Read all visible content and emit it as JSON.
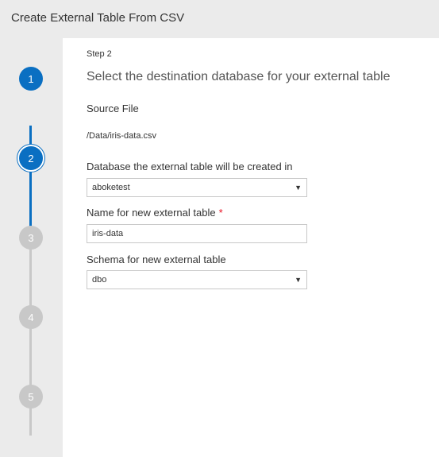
{
  "window": {
    "title": "Create External Table From CSV"
  },
  "stepper": {
    "steps": [
      {
        "number": "1",
        "state": "complete"
      },
      {
        "number": "2",
        "state": "active"
      },
      {
        "number": "3",
        "state": "pending"
      },
      {
        "number": "4",
        "state": "pending"
      },
      {
        "number": "5",
        "state": "pending"
      }
    ],
    "colors": {
      "active": "#0a6fc2",
      "pending": "#c8c8c8"
    }
  },
  "main": {
    "step_label": "Step 2",
    "step_title": "Select the destination database for your external table",
    "source_heading": "Source File",
    "source_path": "/Data/iris-data.csv",
    "database_field": {
      "label": "Database the external table will be created in",
      "value": "aboketest",
      "icon": "chevron-down-icon"
    },
    "table_name_field": {
      "label": "Name for new external table",
      "required_marker": "*",
      "value": "iris-data"
    },
    "schema_field": {
      "label": "Schema for new external table",
      "value": "dbo",
      "icon": "chevron-down-icon"
    }
  }
}
